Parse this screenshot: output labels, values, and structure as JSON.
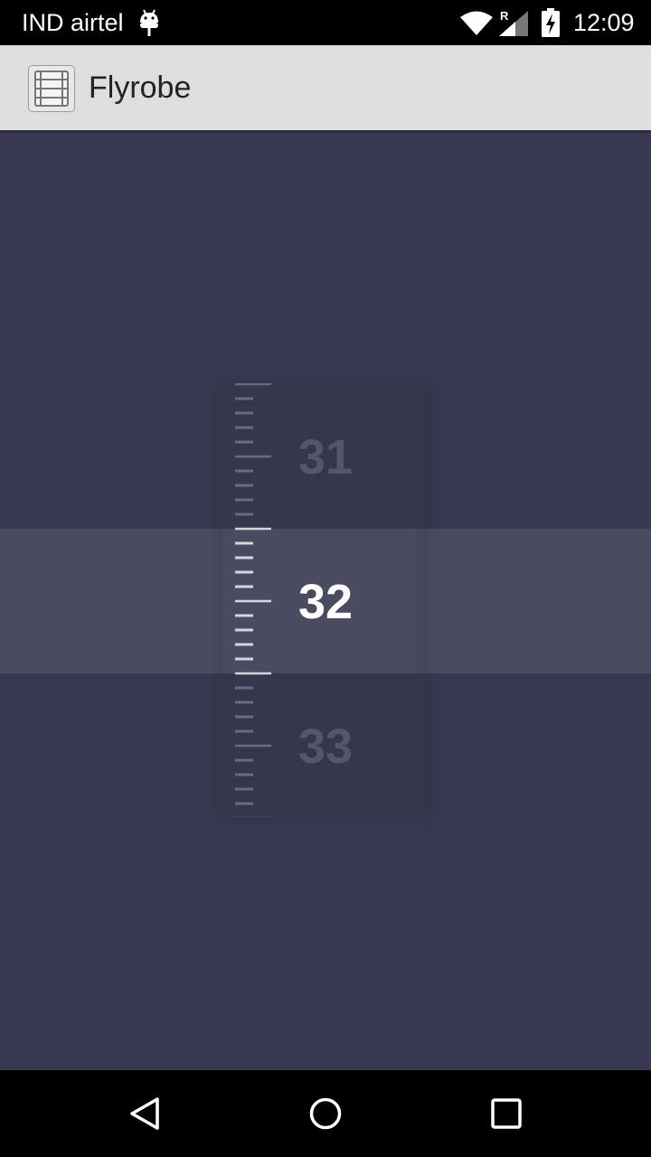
{
  "status_bar": {
    "carrier": "IND airtel",
    "roaming": "R",
    "time": "12:09"
  },
  "action_bar": {
    "title": "Flyrobe",
    "icon": "film-strip-icon"
  },
  "picker": {
    "values": [
      "31",
      "32",
      "33"
    ],
    "selected": "32"
  },
  "nav_bar": {
    "back": "back-icon",
    "home": "home-icon",
    "recents": "recents-icon"
  },
  "colors": {
    "background": "#383850",
    "highlight": "#4a4b60",
    "action_bar": "#dedede",
    "dim_number": "#555668",
    "selected_number": "#ffffff"
  }
}
